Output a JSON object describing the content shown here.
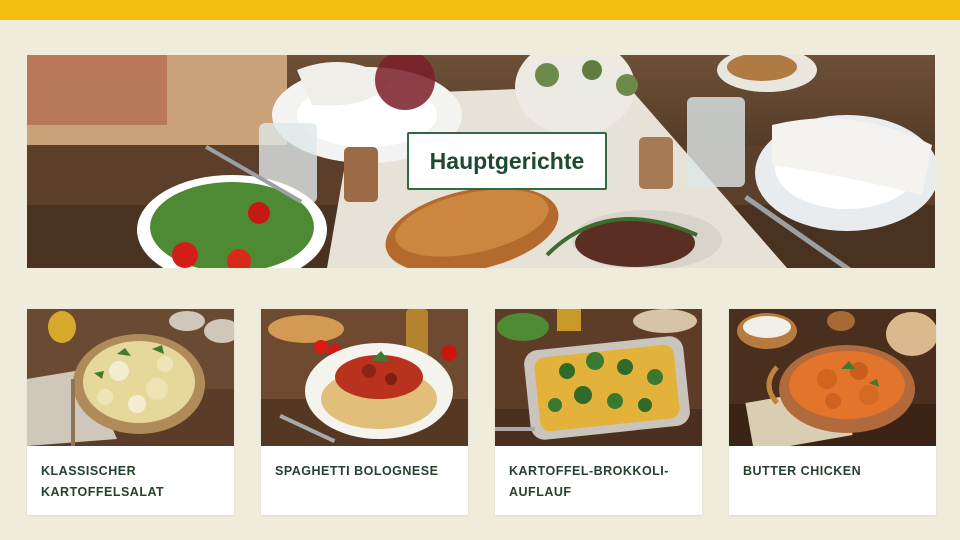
{
  "hero": {
    "title": "Hauptgerichte"
  },
  "colors": {
    "topbar": "#f2bd0f",
    "background": "#f0ecdc",
    "accent": "#2f6a43",
    "card_text": "#24422e"
  },
  "recipes": [
    {
      "title": "KLASSISCHER KARTOFFELSALAT",
      "image": "potato-salad-photo"
    },
    {
      "title": "SPAGHETTI BOLOGNESE",
      "image": "spaghetti-bolognese-photo"
    },
    {
      "title": "KARTOFFEL-BROKKOLI-AUFLAUF",
      "image": "potato-broccoli-casserole-photo"
    },
    {
      "title": "BUTTER CHICKEN",
      "image": "butter-chicken-photo"
    }
  ]
}
